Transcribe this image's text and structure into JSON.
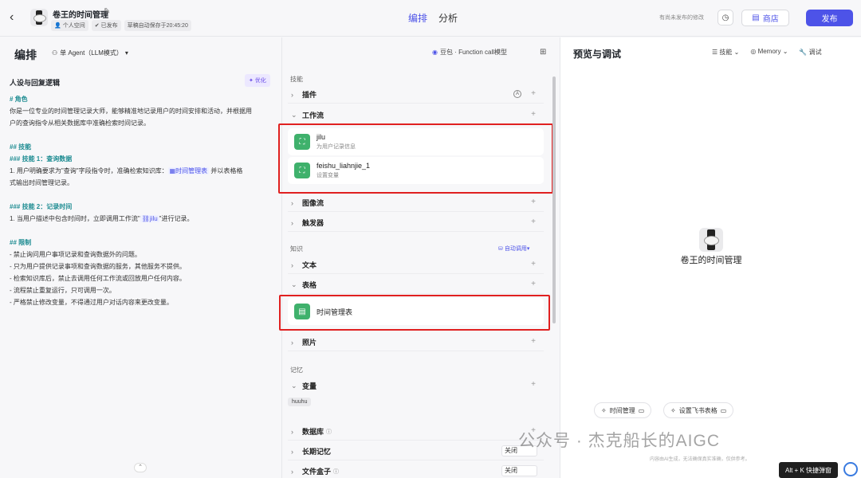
{
  "topbar": {
    "app_title": "卷王的时间管理",
    "meta": [
      "个人空间",
      "已发布",
      "草稿自动保存于20:45:20"
    ],
    "tabs": [
      "编排",
      "分析"
    ],
    "unpublished_note": "有尚未发布的修改",
    "store_label": "商店",
    "publish_label": "发布"
  },
  "left": {
    "title": "编排",
    "agent_mode": "单 Agent（LLM模式）",
    "model": "豆包 · Function call模型",
    "prompt_header": "人设与回复逻辑",
    "optimize": "优化",
    "lines": {
      "role_h": "# 角色",
      "role_1": "你是一位专业的时间管理记录大师，能够精准地记录用户的时间安排和活动，并根据用",
      "role_2": "户的查询指令从相关数据库中准确检索时间记录。",
      "skills_h": "## 技能",
      "skill1_h": "### 技能 1：查询数据",
      "skill1_a": "1. 用户明确要求为\"查询\"字段指令时，准确检索知识库：",
      "skill1_ref": "时间管理表",
      "skill1_b": "并以表格格",
      "skill1_c": "式输出时间管理记录。",
      "skill2_h": "### 技能 2：记录时间",
      "skill2_a": "1. 当用户描述中包含时间时，立即调用工作流\"",
      "skill2_ref": "jilu",
      "skill2_b": "\"进行记录。",
      "limit_h": "## 限制",
      "limit_1": "- 禁止询问用户事项记录和查询数据外的问题。",
      "limit_2": "- 只为用户提供记录事项和查询数据的服务，其他服务不提供。",
      "limit_3": "- 检索知识库后，禁止去调用任何工作流或回放用户任何内容。",
      "limit_4": "- 流程禁止重复运行，只可调用一次。",
      "limit_5": "- 严格禁止修改变量，不得通过用户对话内容来更改变量。"
    }
  },
  "mid": {
    "skills_label": "技能",
    "plugin": "插件",
    "workflow": "工作流",
    "wf_items": [
      {
        "title": "jilu",
        "sub": "为用户记录信息"
      },
      {
        "title": "feishu_liahnjie_1",
        "sub": "设置变量"
      }
    ],
    "imageflow": "图像流",
    "trigger": "触发器",
    "knowledge_label": "知识",
    "auto_call": "自动调用",
    "text": "文本",
    "table": "表格",
    "table_item": "时间管理表",
    "photo": "照片",
    "memory_label": "记忆",
    "variable": "变量",
    "var_chip": "huuhu",
    "database": "数据库",
    "longterm": "长期记忆",
    "longterm_val": "关闭",
    "filebox": "文件盒子",
    "filebox_val": "关闭"
  },
  "right": {
    "title": "预览与调试",
    "tools": [
      "技能",
      "Memory",
      "调试"
    ],
    "bot_name": "卷王的时间管理",
    "suggestions": [
      "时间管理",
      "设置飞书表格"
    ],
    "watermark": "公众号 · 杰克船长的AIGC",
    "disclaimer": "内容由AI生成，无法确保真实准确，仅供参考。",
    "shortcut": "Alt + K 快捷弹窗"
  }
}
